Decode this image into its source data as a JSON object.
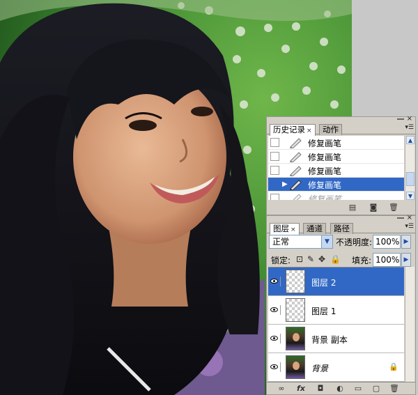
{
  "canvas": {
    "description_icon": "photo-canvas"
  },
  "history_panel": {
    "tabs": [
      {
        "label": "历史记录",
        "close": "×",
        "active": true
      },
      {
        "label": "动作",
        "active": false
      }
    ],
    "items": [
      {
        "label": "修复画笔",
        "state": "normal"
      },
      {
        "label": "修复画笔",
        "state": "normal"
      },
      {
        "label": "修复画笔",
        "state": "normal"
      },
      {
        "label": "修复画笔",
        "state": "selected"
      },
      {
        "label": "修复画笔",
        "state": "dim"
      }
    ],
    "footer_icons": [
      "new-document-icon",
      "snapshot-icon",
      "trash-icon"
    ]
  },
  "layers_panel": {
    "tabs": [
      {
        "label": "图层",
        "close": "×",
        "active": true
      },
      {
        "label": "通道",
        "active": false
      },
      {
        "label": "路径",
        "active": false
      }
    ],
    "blend_mode": "正常",
    "opacity_label": "不透明度:",
    "opacity_value": "100%",
    "lock_label": "锁定:",
    "fill_label": "填充:",
    "fill_value": "100%",
    "layers": [
      {
        "name": "图层 2",
        "type": "transparent",
        "selected": true
      },
      {
        "name": "图层 1",
        "type": "transparent",
        "selected": false
      },
      {
        "name": "背景 副本",
        "type": "photo",
        "selected": false
      },
      {
        "name": "背景",
        "type": "photo",
        "selected": false,
        "locked": true
      }
    ],
    "footer_icons": [
      "link-icon",
      "fx-icon",
      "mask-icon",
      "adjustment-icon",
      "group-folder-icon",
      "new-layer-icon",
      "trash-icon"
    ],
    "fx_label": "fx"
  },
  "colors": {
    "panel_bg": "#d4d0c8",
    "selection": "#3168c5",
    "workspace": "#c8c8c8"
  }
}
